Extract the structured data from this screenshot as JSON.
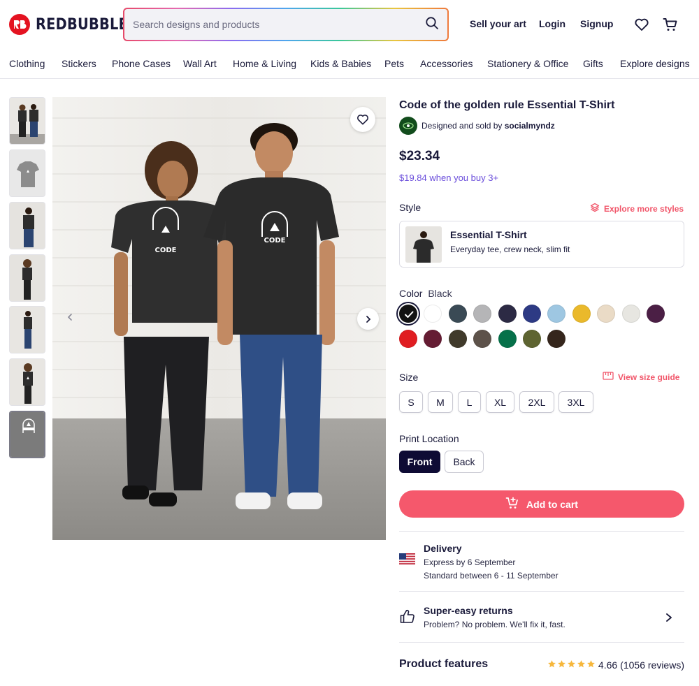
{
  "header": {
    "brand": "REDBUBBLE",
    "search_placeholder": "Search designs and products",
    "sell_label": "Sell your art",
    "login_label": "Login",
    "signup_label": "Signup"
  },
  "nav": [
    "Clothing",
    "Stickers",
    "Phone Cases",
    "Wall Art",
    "Home & Living",
    "Kids & Babies",
    "Pets",
    "Accessories",
    "Stationery & Office",
    "Gifts",
    "Explore designs"
  ],
  "gallery": {
    "image_text": "CODE",
    "thumbnail_count": 7,
    "active_thumbnail": 7
  },
  "product": {
    "title": "Code of the golden rule Essential T-Shirt",
    "designed_by_prefix": "Designed and sold by ",
    "artist": "socialmyndz",
    "price": "$23.34",
    "bulk_price": "$19.84 when you buy 3+",
    "style_label": "Style",
    "explore_styles": "Explore more styles",
    "style_name": "Essential T-Shirt",
    "style_desc": "Everyday tee, crew neck, slim fit",
    "color_label": "Color",
    "color_value": "Black",
    "colors": [
      "#121212",
      "#ffffff",
      "#3a4a55",
      "#b5b5b7",
      "#2c2a44",
      "#2d3a84",
      "#9ec7e2",
      "#eab92b",
      "#eadbc6",
      "#e7e6e1",
      "#4b1f45",
      "#e01d21",
      "#651c33",
      "#403a2b",
      "#5d524a",
      "#06714a",
      "#5e6431",
      "#35261c"
    ],
    "size_label": "Size",
    "size_guide": "View size guide",
    "sizes": [
      "S",
      "M",
      "L",
      "XL",
      "2XL",
      "3XL"
    ],
    "print_location_label": "Print Location",
    "locations": [
      "Front",
      "Back"
    ],
    "add_to_cart": "Add to cart"
  },
  "delivery": {
    "title": "Delivery",
    "express": "Express by 6 September",
    "standard": "Standard between 6 - 11 September"
  },
  "returns": {
    "title": "Super-easy returns",
    "sub": "Problem? No problem. We'll fix it, fast."
  },
  "features": {
    "title": "Product features",
    "rating": "4.66",
    "reviews": "(1056 reviews)",
    "stars": 5
  }
}
